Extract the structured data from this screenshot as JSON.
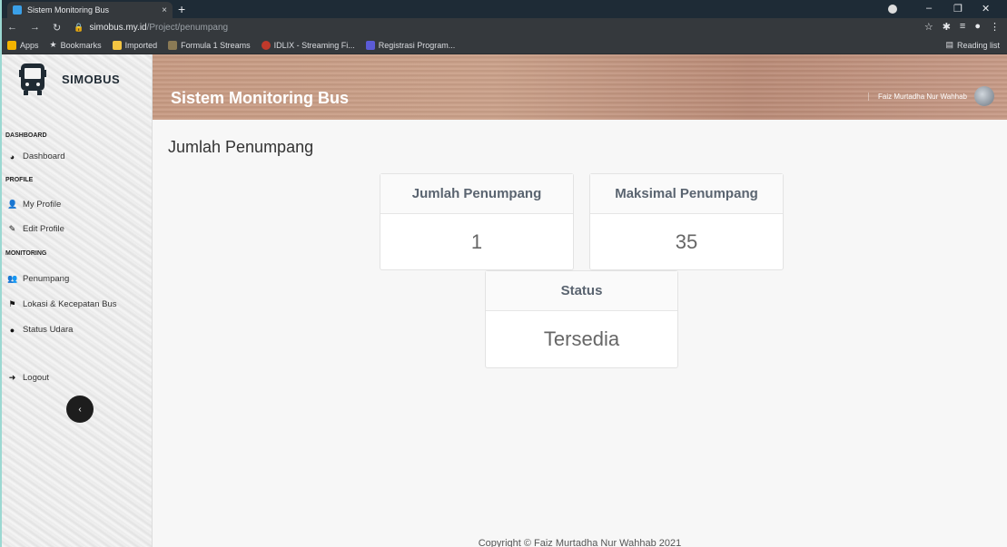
{
  "browser": {
    "tab_title": "Sistem Monitoring Bus",
    "tab_close": "×",
    "new_tab": "+",
    "url_host": "simobus.my.id",
    "url_path": "/Project/penumpang",
    "reading_list": "Reading list",
    "bookmarks": [
      {
        "label": "Apps",
        "icon": "apps-grid-icon",
        "color": "#f4b400"
      },
      {
        "label": "Bookmarks",
        "icon": "star-icon",
        "color": "#e8eaed"
      },
      {
        "label": "Imported",
        "icon": "folder-icon",
        "color": "#f4c542"
      },
      {
        "label": "Formula 1 Streams",
        "icon": "f1-icon",
        "color": "#8a7a55"
      },
      {
        "label": "IDLIX - Streaming Fi...",
        "icon": "idlix-icon",
        "color": "#c0392b"
      },
      {
        "label": "Registrasi Program...",
        "icon": "registrasi-icon",
        "color": "#5b5bd6"
      }
    ]
  },
  "sidebar": {
    "brand": "SIMOBUS",
    "sections": {
      "dashboard": "DASHBOARD",
      "profile": "PROFILE",
      "monitoring": "MONITORING"
    },
    "items": {
      "dashboard": "Dashboard",
      "my_profile": "My Profile",
      "edit_profile": "Edit Profile",
      "penumpang": "Penumpang",
      "lokasi": "Lokasi & Kecepatan Bus",
      "status_udara": "Status Udara",
      "logout": "Logout"
    },
    "collapse": "‹"
  },
  "header": {
    "title": "Sistem Monitoring Bus",
    "user": "Faiz Murtadha Nur Wahhab"
  },
  "main": {
    "page_title": "Jumlah Penumpang",
    "cards": {
      "jumlah": {
        "label": "Jumlah Penumpang",
        "value": "1"
      },
      "maksimal": {
        "label": "Maksimal Penumpang",
        "value": "35"
      },
      "status": {
        "label": "Status",
        "value": "Tersedia"
      }
    }
  },
  "footer": {
    "text": "Copyright © Faiz Murtadha Nur Wahhab 2021"
  }
}
